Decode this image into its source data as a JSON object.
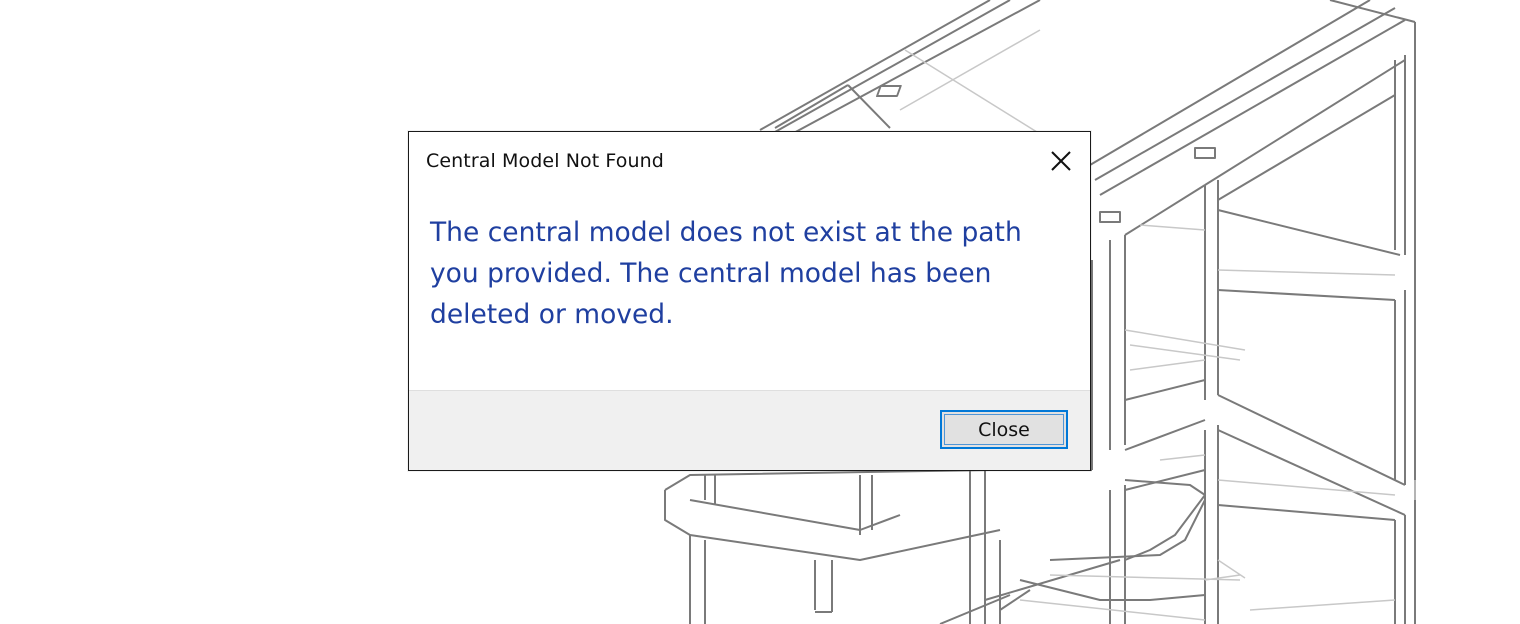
{
  "dialog": {
    "title": "Central Model Not Found",
    "message": "The central model does not exist at the path you provided.  The central model has been deleted or moved.",
    "close_button_label": "Close",
    "close_icon": "close-icon",
    "message_color": "#1f3fa0",
    "button_focus_color": "#0078d7"
  },
  "background": {
    "description_icon": "building-wireframe-drawing"
  }
}
